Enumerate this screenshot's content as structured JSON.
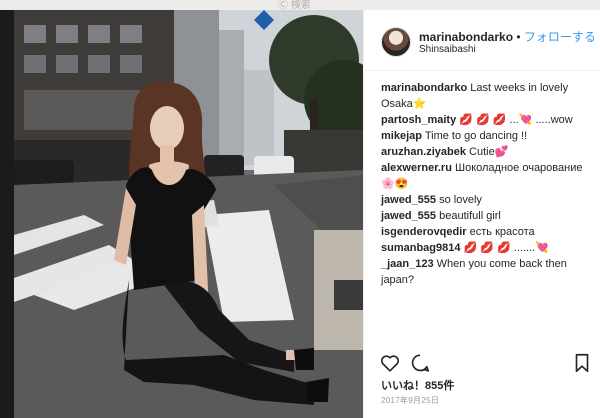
{
  "top_strip": {
    "faded_text": "Ⓒ 検索"
  },
  "post": {
    "username": "marinabondarko",
    "separator": "•",
    "follow_label": "フォローする",
    "location": "Shinsaibashi",
    "likes_text": "いいね！855件",
    "date_text": "2017年9月25日"
  },
  "comments": [
    {
      "user": "marinabondarko",
      "text": "Last weeks in lovely Osaka⭐"
    },
    {
      "user": "partosh_maity",
      "text": "💋 💋 💋 ...💘 .....wow"
    },
    {
      "user": "mikejap",
      "text": "Time to go dancing !!"
    },
    {
      "user": "aruzhan.ziyabek",
      "text": "Cutie💕"
    },
    {
      "user": "alexwerner.ru",
      "text": "Шоколадное очарование🌸😍"
    },
    {
      "user": "jawed_555",
      "text": "so lovely"
    },
    {
      "user": "jawed_555",
      "text": "beautifull girl"
    },
    {
      "user": "isgenderovqedir",
      "text": "есть красота"
    },
    {
      "user": "sumanbag9814",
      "text": "💋 💋 💋 .......💘"
    },
    {
      "user": "_jaan_123",
      "text": "When you come back then japan?"
    }
  ],
  "icons": {
    "like": "heart-icon",
    "comment": "comment-icon",
    "save": "bookmark-icon"
  },
  "colors": {
    "accent": "#3897f0",
    "text": "#262626",
    "muted": "#999999"
  }
}
